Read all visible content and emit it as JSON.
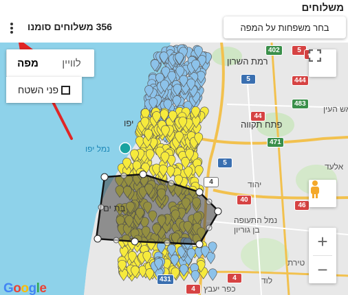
{
  "header": {
    "title": "משלוחים",
    "select_families_button": "בחר משפחות על המפה",
    "selected_count_text": "356 משלוחים סומנו"
  },
  "map": {
    "type_control": {
      "map_label": "מפה",
      "satellite_label": "לוויין",
      "terrain_label": "פני השטח"
    },
    "zoom_in": "+",
    "zoom_out": "−",
    "labels": {
      "ramat_hasharon": "רמת השרון",
      "petah_tikva": "פתח תקווה",
      "jaffa": "נמל יפו",
      "yafo": "יפו",
      "bat_yam": "בת ים",
      "airport": "נמל התעופה",
      "ben_gurion": "בן גוריון",
      "lod": "לוד",
      "elad": "אלעד",
      "rosh_haayin": "ראש העין",
      "yehud": "יהוד",
      "tirat": "טירת",
      "kfar_yaavets": "כפר יעבץ"
    },
    "roads": [
      "402",
      "5",
      "483",
      "5",
      "444",
      "471",
      "40",
      "4",
      "46",
      "431",
      "40",
      "4",
      "5",
      "44",
      "4"
    ],
    "google": [
      "G",
      "o",
      "o",
      "g",
      "l",
      "e"
    ],
    "google_colors": [
      "#4285F4",
      "#EA4335",
      "#FBBC05",
      "#4285F4",
      "#34A853",
      "#EA4335"
    ]
  },
  "icons": {
    "kebab": "more-vert-icon",
    "fullscreen": "fullscreen-icon",
    "pegman": "pegman-icon"
  },
  "colors": {
    "yellow_marker": "#f6ea3c",
    "blue_marker": "#8cc2ea",
    "polygon_fill": "#444444",
    "arrow": "#e02626"
  }
}
